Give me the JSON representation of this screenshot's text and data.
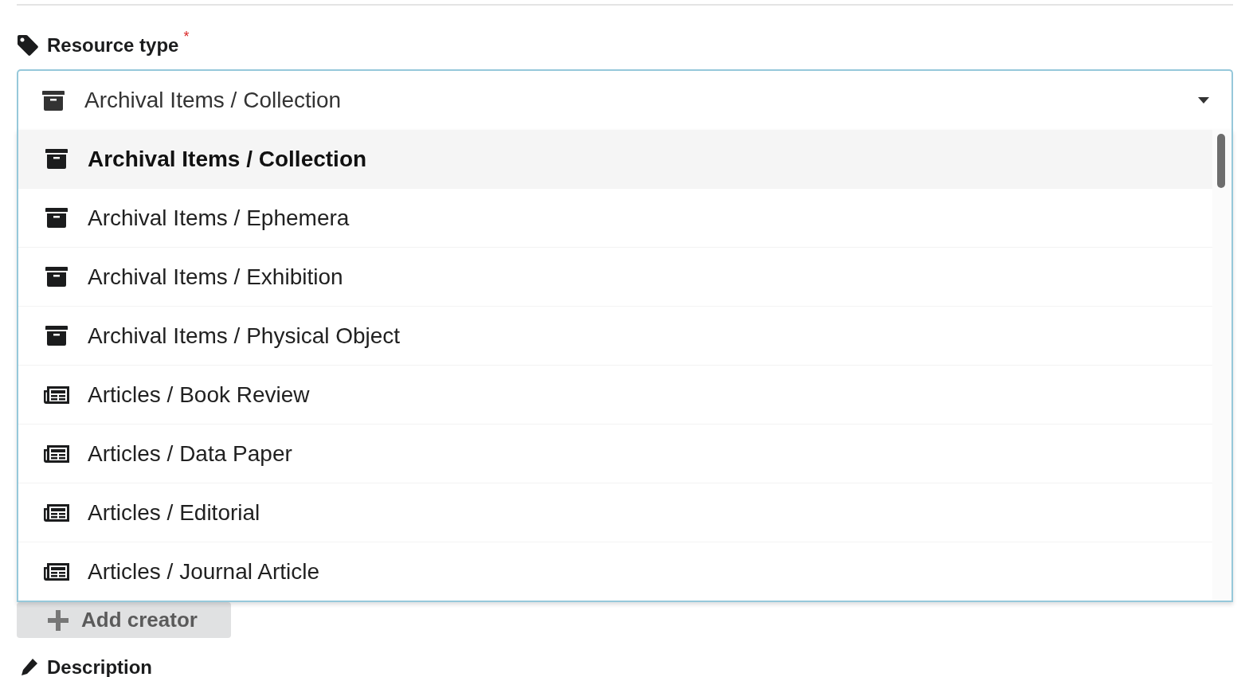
{
  "field": {
    "label": "Resource type",
    "required_mark": "*",
    "expanded": true,
    "value": {
      "kind": "archival",
      "label": "Archival Items / Collection"
    },
    "options": [
      {
        "kind": "archival",
        "label": "Archival Items / Collection",
        "selected": true
      },
      {
        "kind": "archival",
        "label": "Archival Items / Ephemera",
        "selected": false
      },
      {
        "kind": "archival",
        "label": "Archival Items / Exhibition",
        "selected": false
      },
      {
        "kind": "archival",
        "label": "Archival Items / Physical Object",
        "selected": false
      },
      {
        "kind": "article",
        "label": "Articles / Book Review",
        "selected": false
      },
      {
        "kind": "article",
        "label": "Articles / Data Paper",
        "selected": false
      },
      {
        "kind": "article",
        "label": "Articles / Editorial",
        "selected": false
      },
      {
        "kind": "article",
        "label": "Articles / Journal Article",
        "selected": false
      }
    ]
  },
  "add_creator_button": {
    "label": "Add creator"
  },
  "next_field": {
    "label": "Description"
  }
}
